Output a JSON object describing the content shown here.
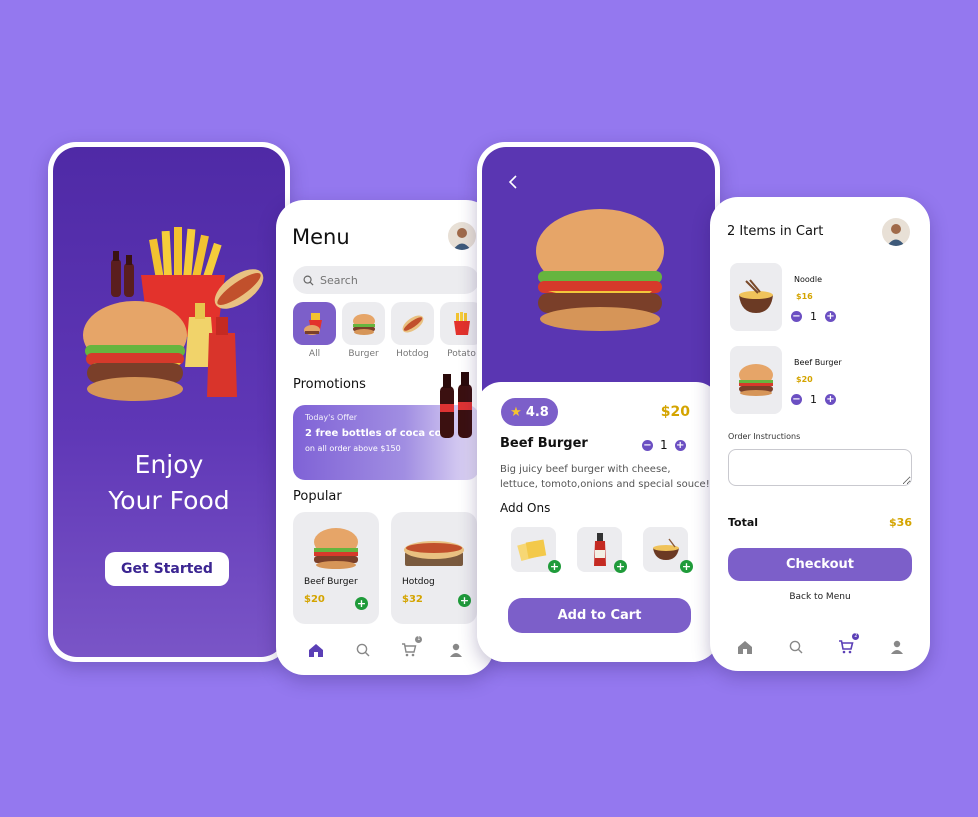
{
  "splash": {
    "title_line1": "Enjoy",
    "title_line2": "Your Food",
    "button": "Get Started"
  },
  "menu": {
    "title": "Menu",
    "search_placeholder": "Search",
    "categories": [
      {
        "label": "All",
        "icon": "combo-meal-icon",
        "active": true
      },
      {
        "label": "Burger",
        "icon": "burger-icon"
      },
      {
        "label": "Hotdog",
        "icon": "hotdog-icon"
      },
      {
        "label": "Potato",
        "icon": "fries-icon"
      }
    ],
    "promotions_title": "Promotions",
    "promo": {
      "tag": "Today's Offer",
      "headline": "2 free bottles of coca cola",
      "sub": "on all order above $150"
    },
    "popular_title": "Popular",
    "popular": [
      {
        "name": "Beef Burger",
        "price": "$20"
      },
      {
        "name": "Hotdog",
        "price": "$32"
      }
    ],
    "cart_badge": "1"
  },
  "detail": {
    "rating": "4.8",
    "price": "$20",
    "name": "Beef Burger",
    "quantity": "1",
    "description": "Big juicy beef burger with cheese, lettuce, tomoto,onions and special souce!",
    "addons_title": "Add Ons",
    "addons": [
      "cheese-slices-icon",
      "ketchup-bottle-icon",
      "noodle-bowl-icon"
    ],
    "button": "Add to Cart"
  },
  "cart": {
    "title": "2 Items in Cart",
    "items": [
      {
        "name": "Noodle",
        "price": "$16",
        "qty": "1"
      },
      {
        "name": "Beef Burger",
        "price": "$20",
        "qty": "1"
      }
    ],
    "instructions_label": "Order Instructions",
    "total_label": "Total",
    "total_value": "$36",
    "checkout": "Checkout",
    "back": "Back to Menu",
    "cart_badge": "2"
  },
  "colors": {
    "background": "#9478ef",
    "primary": "#7c5fc9",
    "deep": "#4f2aa6",
    "price": "#d4a400",
    "add": "#1f9b3a"
  }
}
